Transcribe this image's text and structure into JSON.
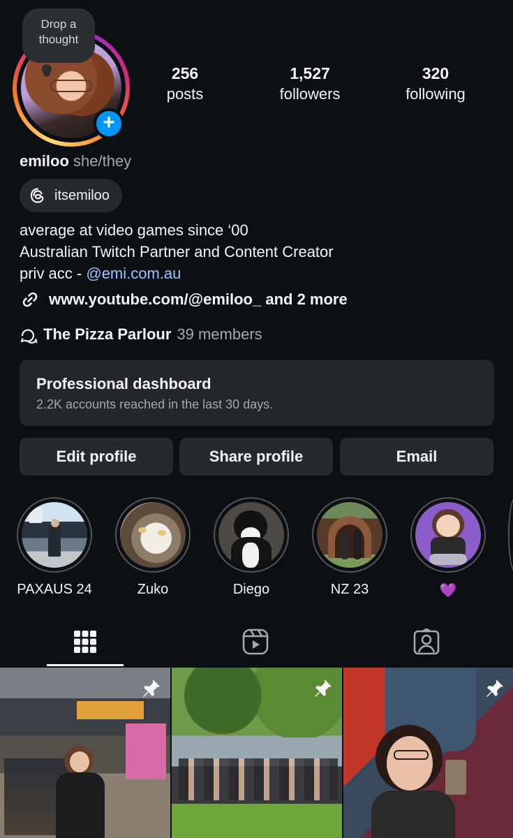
{
  "avatar": {
    "thought_bubble": "Drop a thought"
  },
  "stats": [
    {
      "value": "256",
      "label": "posts"
    },
    {
      "value": "1,527",
      "label": "followers"
    },
    {
      "value": "320",
      "label": "following"
    }
  ],
  "profile": {
    "username": "emiloo",
    "pronouns": "she/they",
    "threads_handle": "itsemiloo",
    "bio_line1": "average at video games since ‘00",
    "bio_line2": "Australian Twitch Partner and Content Creator",
    "bio_line3_prefix": "priv acc - ",
    "bio_line3_mention": "@emi.com.au",
    "link_text": "www.youtube.com/@emiloo_ and 2 more",
    "channel_name": "The Pizza Parlour",
    "channel_members": "39 members"
  },
  "dashboard": {
    "title": "Professional dashboard",
    "subtitle": "2.2K accounts reached in the last 30 days."
  },
  "actions": {
    "edit": "Edit profile",
    "share": "Share profile",
    "email": "Email"
  },
  "highlights": [
    {
      "label": "PAXAUS 24"
    },
    {
      "label": "Zuko"
    },
    {
      "label": "Diego"
    },
    {
      "label": "NZ 23"
    },
    {
      "label": "💜"
    }
  ],
  "tabs": [
    "grid-icon",
    "reels-icon",
    "tagged-icon"
  ],
  "colors": {
    "accent": "#0095f6",
    "mention": "#99c4ff",
    "background": "#0c1014",
    "surface": "#26292d"
  }
}
